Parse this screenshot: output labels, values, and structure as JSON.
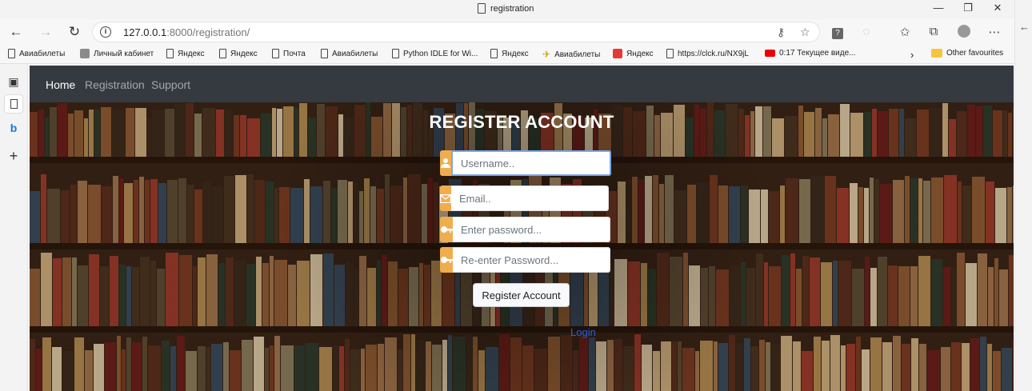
{
  "browser": {
    "tab_title": "registration",
    "url_host": "127.0.0.1",
    "url_rest": ":8000/registration/",
    "window_controls": [
      "—",
      "❐",
      "✕"
    ]
  },
  "bookmarks": [
    {
      "label": "Авиабилеты",
      "icon": "page-icon"
    },
    {
      "label": "Личный кабинет",
      "icon": "cabinet-icon"
    },
    {
      "label": "Яндекс",
      "icon": "page-icon"
    },
    {
      "label": "Яндекс",
      "icon": "page-icon"
    },
    {
      "label": "Почта",
      "icon": "page-icon"
    },
    {
      "label": "Авиабилеты",
      "icon": "page-icon"
    },
    {
      "label": "Python IDLE for Wi...",
      "icon": "page-icon"
    },
    {
      "label": "Яндекс",
      "icon": "page-icon"
    },
    {
      "label": "Авиабилеты",
      "icon": "plane-icon"
    },
    {
      "label": "Яндекс",
      "icon": "yandex-icon"
    },
    {
      "label": "https://clck.ru/NX9jL",
      "icon": "page-icon"
    },
    {
      "label": "0:17 Текущее виде...",
      "icon": "youtube-icon"
    }
  ],
  "other_favourites": "Other favourites",
  "site_nav": {
    "home": "Home",
    "registration": "Registration",
    "support": "Support"
  },
  "form": {
    "heading": "REGISTER ACCOUNT",
    "username_placeholder": "Username..",
    "email_placeholder": "Email..",
    "password_placeholder": "Enter password...",
    "repassword_placeholder": "Re-enter Password...",
    "submit_label": "Register Account",
    "login_label": "Login"
  },
  "colors": {
    "navbar": "#343a40",
    "addon": "#f0ad4e",
    "link": "#2563d9"
  }
}
